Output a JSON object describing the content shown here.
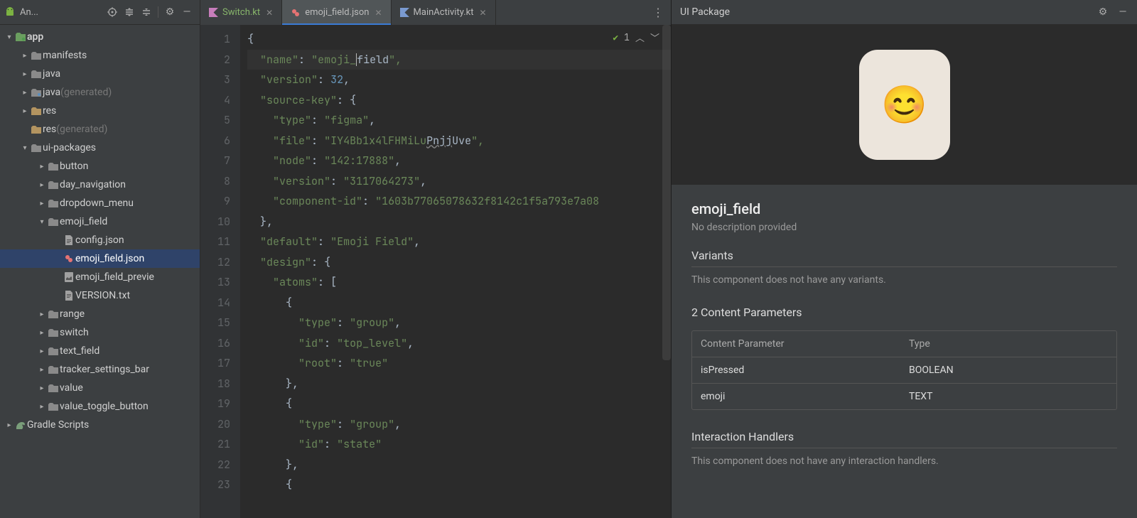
{
  "sidebar": {
    "title": "An...",
    "items": {
      "app": "app",
      "manifests": "manifests",
      "java": "java",
      "java_gen_a": "java ",
      "java_gen_b": "(generated)",
      "res": "res",
      "res_gen_a": "res ",
      "res_gen_b": "(generated)",
      "ui_packages": "ui-packages",
      "button": "button",
      "day_navigation": "day_navigation",
      "dropdown_menu": "dropdown_menu",
      "emoji_field_dir": "emoji_field",
      "config_json": "config.json",
      "emoji_field_json": "emoji_field.json",
      "emoji_field_preview": "emoji_field_previe",
      "version_txt": "VERSION.txt",
      "range": "range",
      "switch": "switch",
      "text_field": "text_field",
      "tracker_settings_bar": "tracker_settings_bar",
      "value": "value",
      "value_toggle_button": "value_toggle_button",
      "gradle_scripts": "Gradle Scripts"
    }
  },
  "tabs": {
    "t0": "Switch.kt",
    "t1": "emoji_field.json",
    "t2": "MainActivity.kt"
  },
  "editor_topright": {
    "count": "1"
  },
  "code_lines": {
    "l1": "{",
    "l2a": "  \"name\": \"emoji_",
    "l2b": "field\",",
    "l3": "  \"version\": 32,",
    "l4": "  \"source-key\": {",
    "l5": "    \"type\": \"figma\",",
    "l6a": "    \"file\": \"IY4Bb1x4lFHMiLu",
    "l6b": "Pnjj",
    "l6c": "Uve\",",
    "l7": "    \"node\": \"142:17888\",",
    "l8": "    \"version\": \"3117064273\",",
    "l9": "    \"component-id\": \"1603b77065078632f8142c1f5a793e7a08",
    "l10": "  },",
    "l11": "  \"default\": \"Emoji Field\",",
    "l12": "  \"design\": {",
    "l13": "    \"atoms\": [",
    "l14": "      {",
    "l15": "        \"type\": \"group\",",
    "l16": "        \"id\": \"top_level\",",
    "l17": "        \"root\": \"true\"",
    "l18": "      },",
    "l19": "      {",
    "l20": "        \"type\": \"group\",",
    "l21": "        \"id\": \"state\"",
    "l22": "      },",
    "l23": "      {"
  },
  "panel": {
    "title": "UI Package",
    "emoji": "😊",
    "name": "emoji_field",
    "description": "No description provided",
    "variants_title": "Variants",
    "variants_body": "This component does not have any variants.",
    "params_title": "2 Content Parameters",
    "params_col_a": "Content Parameter",
    "params_col_b": "Type",
    "p1a": "isPressed",
    "p1b": "BOOLEAN",
    "p2a": "emoji",
    "p2b": "TEXT",
    "handlers_title": "Interaction Handlers",
    "handlers_body": "This component does not have any interaction handlers."
  }
}
